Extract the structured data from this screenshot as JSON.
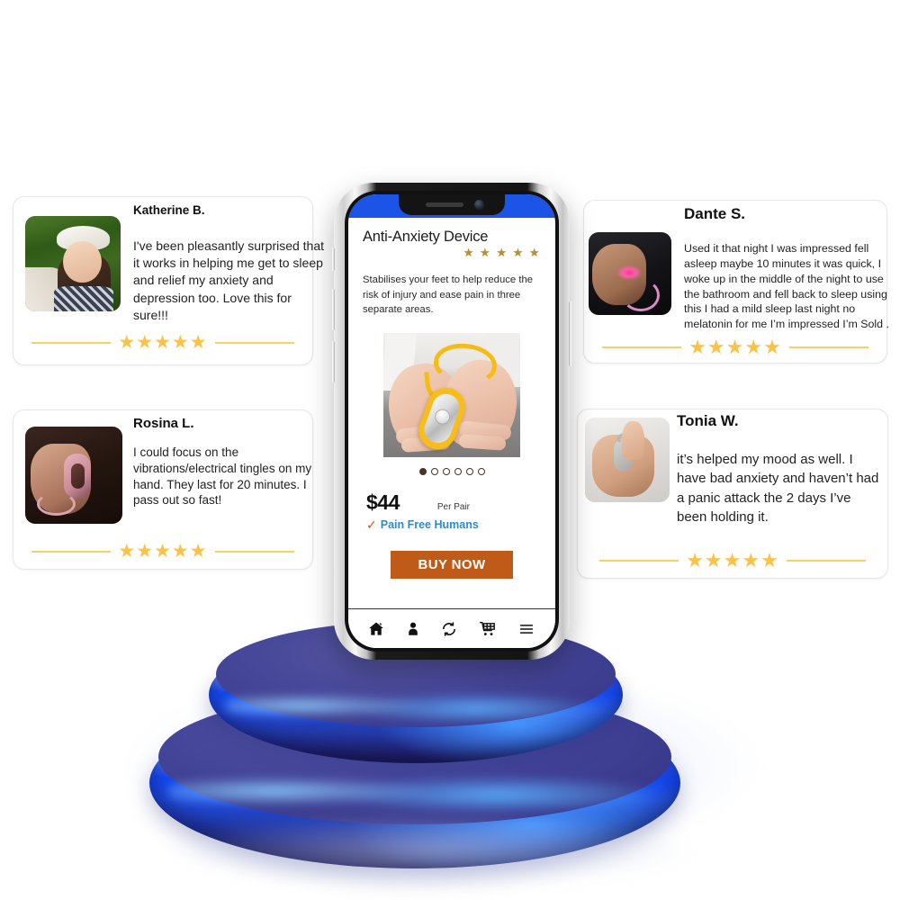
{
  "phone": {
    "product_title": "Anti-Anxiety Device",
    "title_stars": "★ ★ ★ ★ ★",
    "description": "Stabilises your feet to help reduce the risk of injury and ease pain in three separate areas.",
    "carousel": {
      "total_dots": 6,
      "active_index": 0
    },
    "price": "$44",
    "price_unit": "Per Pair",
    "check_glyph": "✓",
    "brand": "Pain Free Humans",
    "buy_label": "BUY NOW",
    "nav": [
      {
        "name": "home-icon",
        "label": "Home"
      },
      {
        "name": "account-icon",
        "label": "Account"
      },
      {
        "name": "sync-icon",
        "label": "Sync"
      },
      {
        "name": "cart-icon",
        "label": "Cart"
      },
      {
        "name": "menu-icon",
        "label": "Menu"
      }
    ]
  },
  "testimonials": [
    {
      "id": "katherine",
      "name": "Katherine B.",
      "text": "I've been pleasantly surprised that it works in helping me get to sleep and relief my anxiety and depression too. Love this for sure!!!",
      "stars": "★★★★★",
      "rating": 5
    },
    {
      "id": "rosina",
      "name": "Rosina L.",
      "text": " I could focus on the vibrations/electrical tingles on my hand. They last for 20 minutes. I pass out so fast!",
      "stars": "★★★★★",
      "rating": 5
    },
    {
      "id": "dante",
      "name": "Dante S.",
      "text": "Used it that night I was impressed fell asleep maybe 10 minutes it was quick, I woke up in the middle of the night to use the bathroom and fell back to sleep using this I had a mild sleep last night no melatonin for me I’m impressed I’m Sold .",
      "stars": "★★★★★",
      "rating": 5
    },
    {
      "id": "tonia",
      "name": "Tonia W.",
      "text": "it’s helped my mood as well. I have bad anxiety and haven’t had a panic attack the 2 days I’ve been holding it.",
      "stars": "★★★★★",
      "rating": 5
    }
  ],
  "colors": {
    "buy_button": "#bf5a18",
    "brand_blue": "#2e8bc9",
    "check_orange": "#c0571a",
    "status_bar_blue": "#1d54e8",
    "card_star_gold": "#fcc247",
    "title_star_gold": "#b8912f",
    "podium_blue": "#1348ef",
    "dot_dark": "#4c3228"
  }
}
